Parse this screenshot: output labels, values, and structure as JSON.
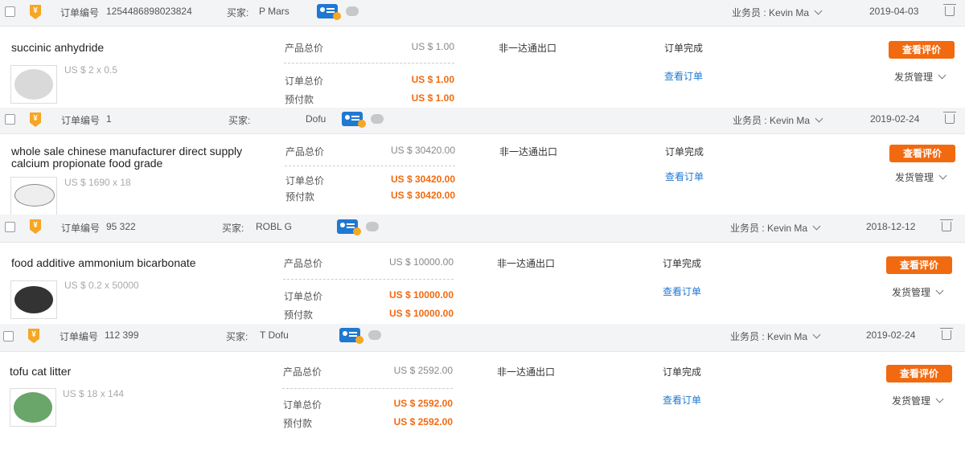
{
  "labels": {
    "order_no": "订单编号",
    "buyer": "买家:",
    "salesman_prefix": "业务员 :",
    "product_total": "产品总价",
    "order_total": "订单总价",
    "prepay": "预付款",
    "view_review": "查看评价",
    "view_order": "查看订单",
    "ship_manage": "发货管理"
  },
  "orders": [
    {
      "order_no_visible": "1254486898023824",
      "buyer_visible": "P Mars",
      "salesman": "Kevin Ma",
      "date": "2019-04-03",
      "title": "succinic anhydride",
      "unit": "US $ 2 x 0.5",
      "product_total": "US $ 1.00",
      "order_total": "US $ 1.00",
      "prepay": "US $ 1.00",
      "trade_mode": "非一达通出口",
      "status": "订单完成",
      "thumb_color": "#e6e6e6"
    },
    {
      "order_no_visible": "1",
      "buyer_visible": "Dofu",
      "salesman": "Kevin Ma",
      "date": "2019-02-24",
      "title": "whole sale chinese manufacturer direct supply calcium propionate food grade",
      "unit": "US $ 1690 x 18",
      "product_total": "US $ 30420.00",
      "order_total": "US $ 30420.00",
      "prepay": "US $ 30420.00",
      "trade_mode": "非一达通出口",
      "status": "订单完成",
      "thumb_color": "#f2f2f2"
    },
    {
      "order_no_visible": "95  322",
      "buyer_visible": "ROBL  G",
      "salesman": "Kevin Ma",
      "date": "2018-12-12",
      "title": "food additive ammonium bicarbonate",
      "unit": "US $ 0.2 x 50000",
      "product_total": "US $ 10000.00",
      "order_total": "US $ 10000.00",
      "prepay": "US $ 10000.00",
      "trade_mode": "非一达通出口",
      "status": "订单完成",
      "thumb_color": "#efefef"
    },
    {
      "order_no_visible": "112  399",
      "buyer_visible": "T  Dofu",
      "salesman": "Kevin Ma",
      "date": "2019-02-24",
      "title": "tofu cat litter",
      "unit": "US $ 18 x 144",
      "product_total": "US $ 2592.00",
      "order_total": "US $ 2592.00",
      "prepay": "US $ 2592.00",
      "trade_mode": "非一达通出口",
      "status": "订单完成",
      "thumb_color": "#6aa56a"
    }
  ],
  "colors": {
    "accent_orange": "#f26a10",
    "link_blue": "#1f78d1",
    "header_bg": "#f3f4f6"
  }
}
